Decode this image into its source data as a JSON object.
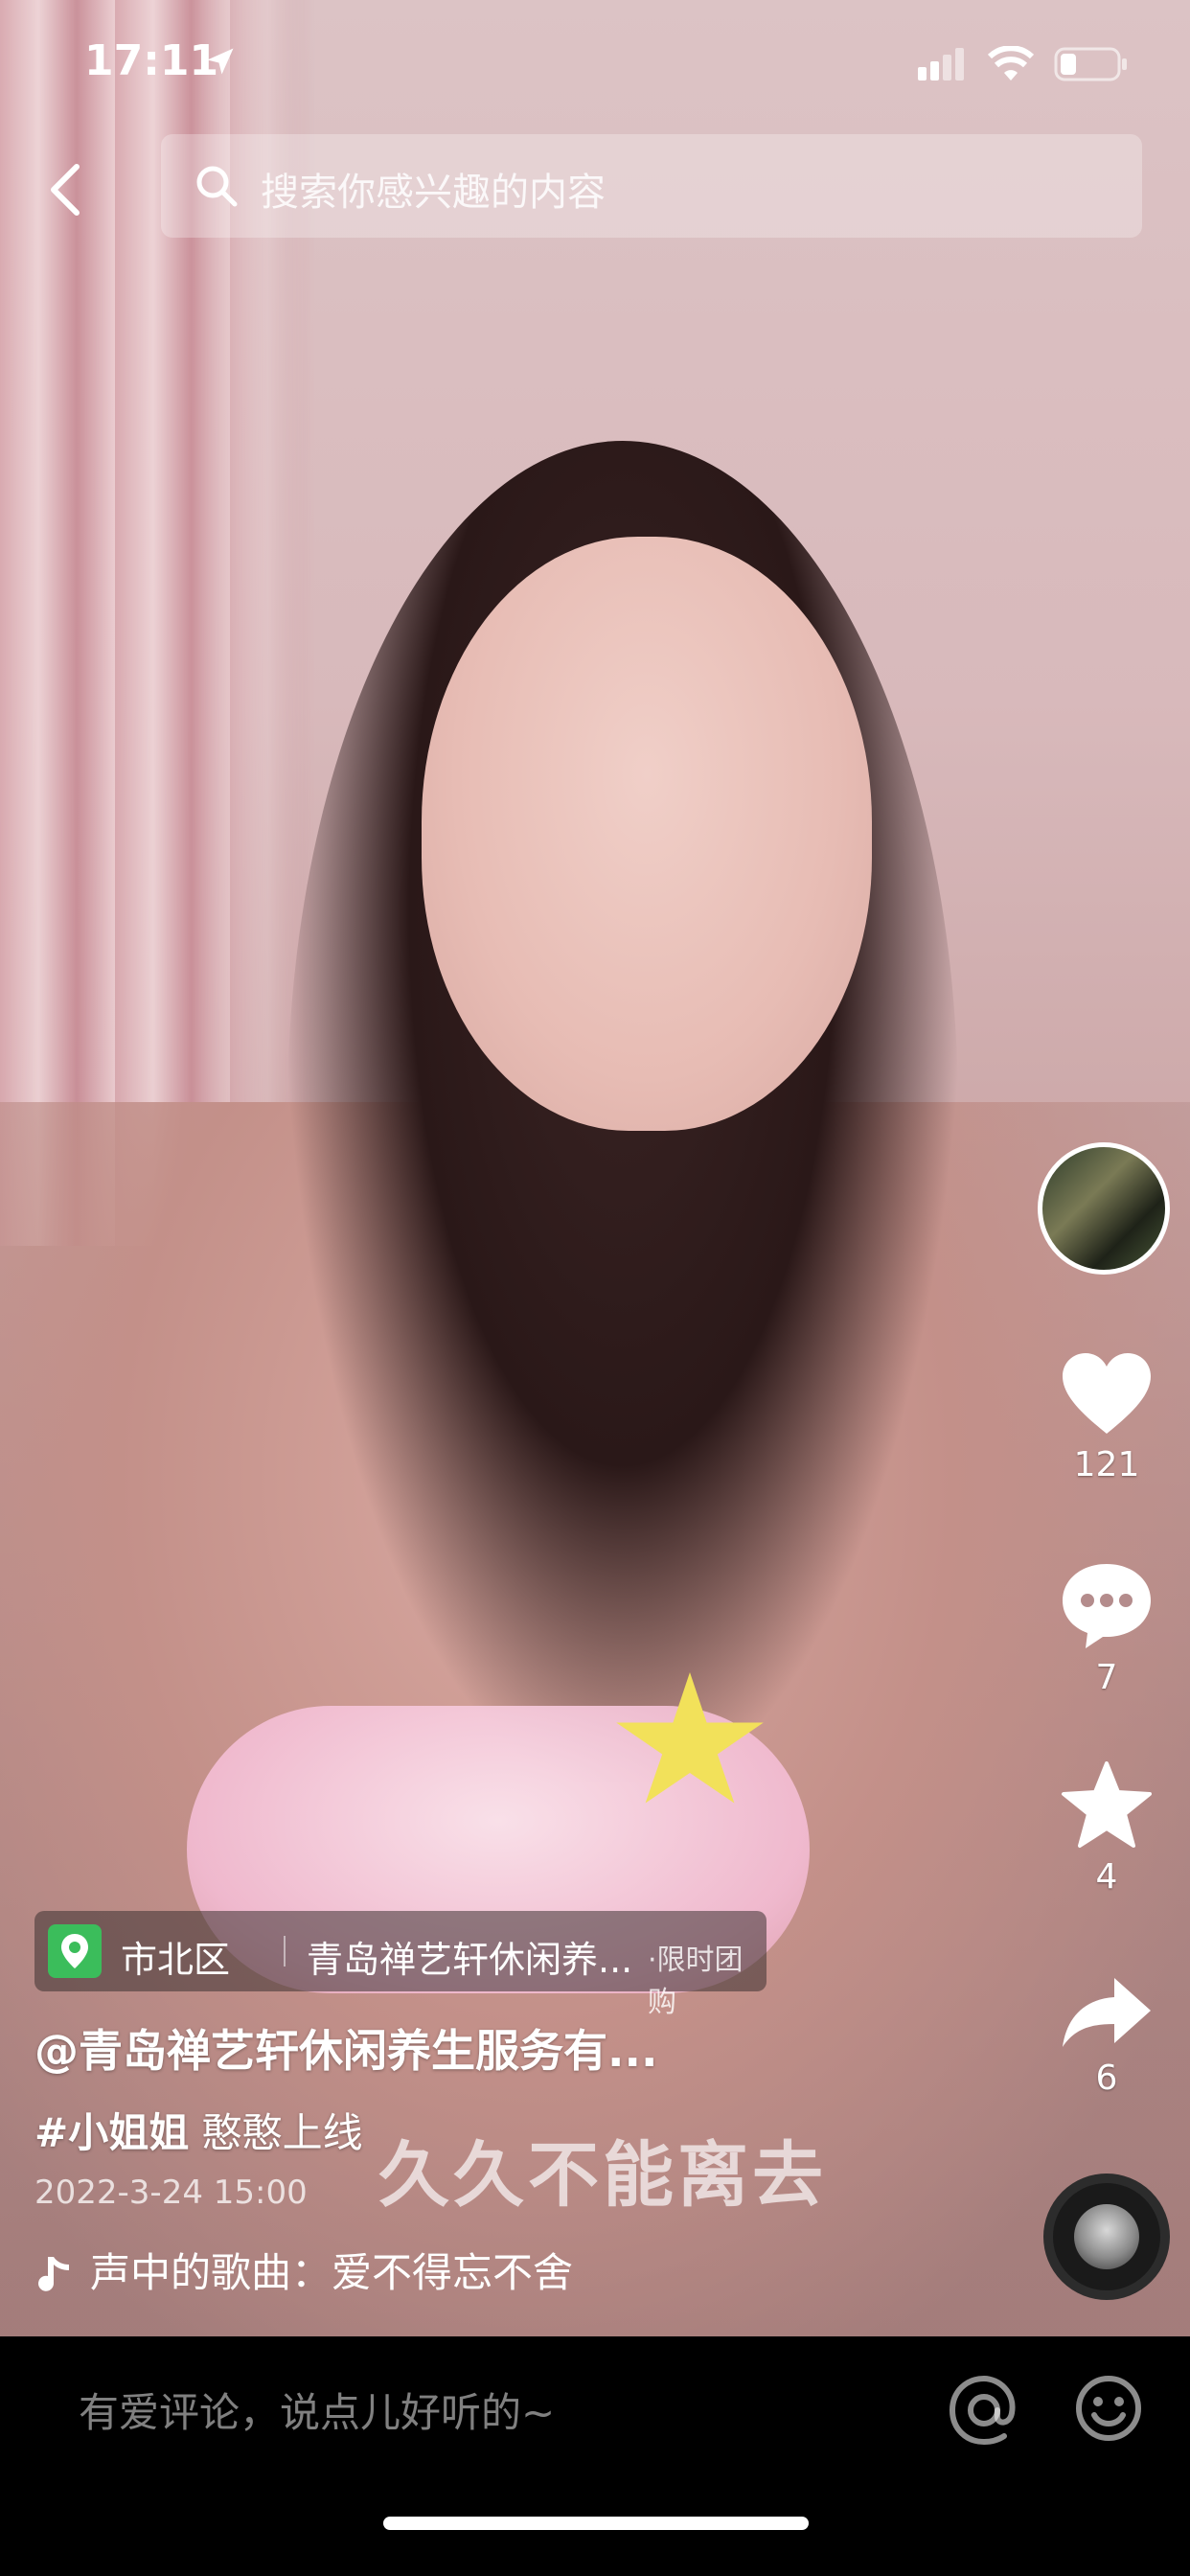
{
  "status_bar": {
    "time": "17:11"
  },
  "search": {
    "placeholder": "搜索你感兴趣的内容"
  },
  "actions": {
    "likes": "121",
    "comments": "7",
    "favorites": "4",
    "shares": "6"
  },
  "poi": {
    "area": "市北区",
    "name": "青岛禅艺轩休闲养...",
    "tag": "·限时团购"
  },
  "post": {
    "author": "@青岛禅艺轩休闲养生服务有...",
    "hashtag": "#小姐姐",
    "text": "憨憨上线",
    "date": "2022-3-24 15:00",
    "video_caption": "久久不能离去",
    "music": "声中的歌曲：爱不得忘不舍"
  },
  "comment_bar": {
    "placeholder": "有爱评论，说点儿好听的~"
  },
  "icons": [
    "location-arrow-icon",
    "signal-icon",
    "wifi-icon",
    "battery-icon",
    "back-icon",
    "search-icon",
    "heart-icon",
    "comment-icon",
    "star-icon",
    "share-icon",
    "music-note-icon",
    "at-icon",
    "emoji-icon",
    "map-pin-icon"
  ],
  "colors": {
    "poi_pin": "#3bbd5b",
    "background": "#000000"
  }
}
